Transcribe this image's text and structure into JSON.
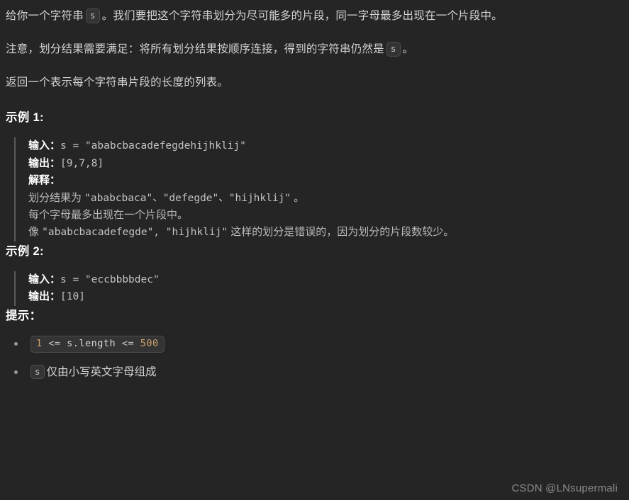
{
  "theme": {
    "background": "#252526",
    "text": "#d4d4d4",
    "heading": "#ffffff",
    "code_chip_bg": "#343434",
    "code_chip_border": "#4d4d4d",
    "blockquote_border": "#5a5a5a",
    "watermark": "#8c8c8c",
    "number_token": "#c9a26d"
  },
  "intro": {
    "p1_before": "给你一个字符串",
    "p1_chip": "s",
    "p1_after": "。我们要把这个字符串划分为尽可能多的片段，同一字母最多出现在一个片段中。",
    "p2_before": "注意，划分结果需要满足：将所有划分结果按顺序连接，得到的字符串仍然是",
    "p2_chip": "s",
    "p2_after": "。",
    "p3": "返回一个表示每个字符串片段的长度的列表。"
  },
  "examples": [
    {
      "heading": "示例 1:",
      "input_label": "输入：",
      "input_value": "s = \"ababcbacadefegdehijhklij\"",
      "output_label": "输出：",
      "output_value": "[9,7,8]",
      "explain_label": "解释：",
      "explain_lines": [
        {
          "cn_before": "划分结果为 ",
          "code": "\"ababcbaca\"、\"defegde\"、\"hijhklij\"",
          "cn_after": " 。"
        },
        {
          "cn_before": "每个字母最多出现在一个片段中。",
          "code": "",
          "cn_after": ""
        },
        {
          "cn_before": "像 ",
          "code": "\"ababcbacadefegde\", \"hijhklij\"",
          "cn_after": " 这样的划分是错误的，因为划分的片段数较少。"
        }
      ]
    },
    {
      "heading": "示例 2:",
      "input_label": "输入：",
      "input_value": "s = \"eccbbbbdec\"",
      "output_label": "输出：",
      "output_value": "[10]",
      "explain_label": "",
      "explain_lines": []
    }
  ],
  "hints": {
    "heading": "提示：",
    "items": [
      {
        "type": "code",
        "tokens": [
          {
            "text": "1",
            "kind": "num"
          },
          {
            "text": " <= ",
            "kind": "op"
          },
          {
            "text": "s.length",
            "kind": "id"
          },
          {
            "text": " <= ",
            "kind": "op"
          },
          {
            "text": "500",
            "kind": "num"
          }
        ]
      },
      {
        "type": "chip_text",
        "chip": "s",
        "text": "仅由小写英文字母组成"
      }
    ]
  },
  "watermark": "CSDN @LNsupermali"
}
